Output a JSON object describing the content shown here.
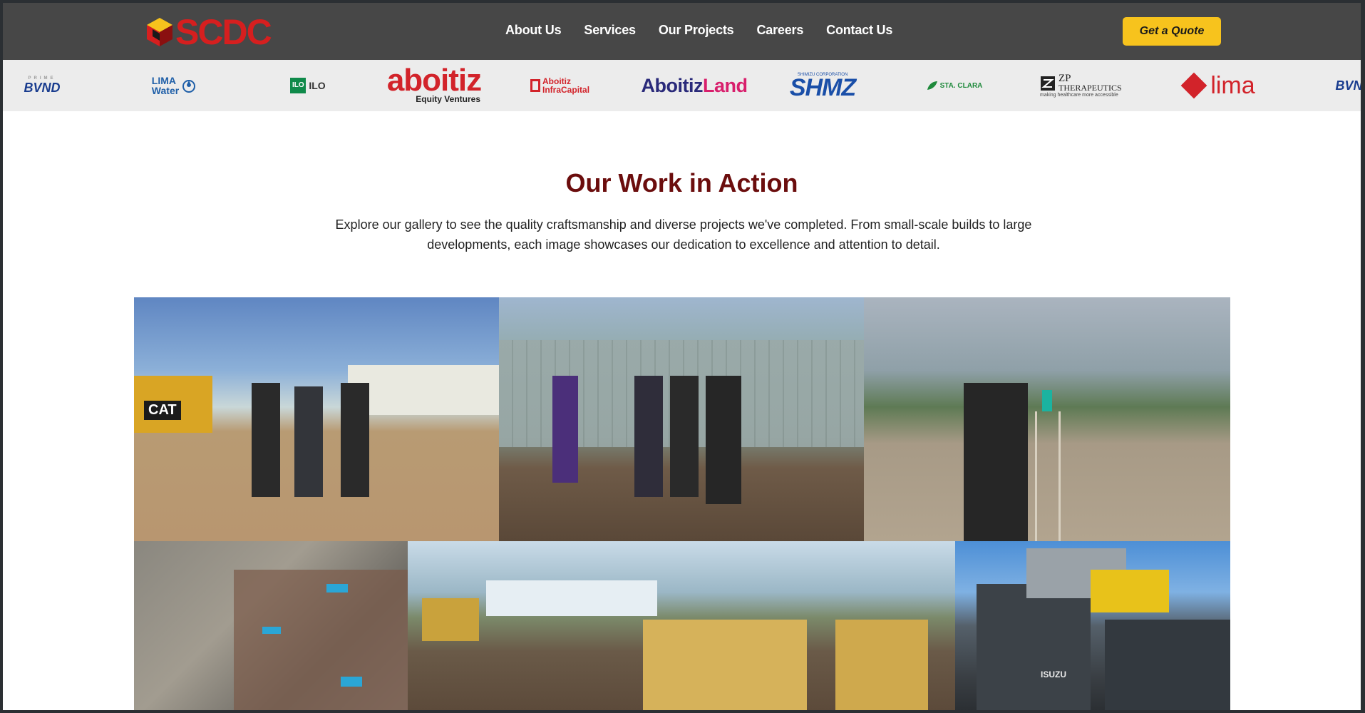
{
  "header": {
    "logo_text": "SCDC",
    "nav": [
      "About Us",
      "Services",
      "Our Projects",
      "Careers",
      "Contact Us"
    ],
    "cta_label": "Get a Quote"
  },
  "partners": {
    "prime": "BVND",
    "prime_small": "PRIME",
    "lima_water": "LIMA\nWater",
    "ilo": "ILO",
    "ilo_mark": "ILO",
    "aboitiz_big": "aboitiz",
    "aboitiz_sub": "Equity Ventures",
    "infra": "Aboitiz InfraCapital",
    "land_a": "Aboitiz",
    "land_b": "Land",
    "shmz_tiny": "SHIMIZU CORPORATION",
    "shmz": "SHMZ",
    "sta_clara": "STA. CLARA",
    "zp_1": "ZP",
    "zp_2": "THERAPEUTICS",
    "zp_tag": "making healthcare more accessible",
    "lima_land": "lima",
    "prime_end": "BVND"
  },
  "section": {
    "title": "Our Work in Action",
    "description": "Explore our gallery to see the quality craftsmanship and diverse projects we've completed. From small-scale builds to large developments, each image showcases our dedication to excellence and attention to detail."
  },
  "gallery": {
    "photos": [
      {
        "name": "engineers-reviewing-plans",
        "caption": "CAT"
      },
      {
        "name": "team-at-fenced-site",
        "caption": ""
      },
      {
        "name": "surveyor-with-level",
        "caption": ""
      },
      {
        "name": "aerial-rebar-site",
        "caption": ""
      },
      {
        "name": "excavators-at-pit",
        "caption": ""
      },
      {
        "name": "isuzu-dump-trucks",
        "caption": "ISUZU"
      }
    ]
  },
  "colors": {
    "header_bg": "#474747",
    "accent_yellow": "#f7c31d",
    "title_maroon": "#6b0d0d",
    "logo_red": "#d61f1f"
  }
}
